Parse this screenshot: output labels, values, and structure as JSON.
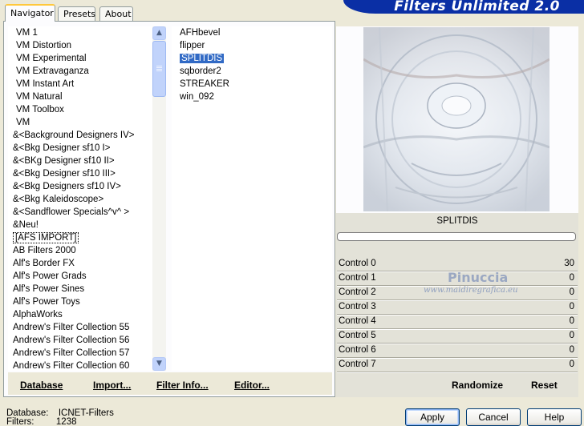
{
  "app": {
    "title": "Filters Unlimited 2.0"
  },
  "tabs": [
    {
      "label": "Navigator",
      "active": true
    },
    {
      "label": "Presets",
      "active": false
    },
    {
      "label": "About",
      "active": false
    }
  ],
  "categories": {
    "items": [
      "VM 1",
      "VM Distortion",
      "VM Experimental",
      "VM Extravaganza",
      "VM Instant Art",
      "VM Natural",
      "VM Toolbox",
      "VM",
      "&<Background Designers IV>",
      "&<Bkg Designer sf10 I>",
      "&<BKg Designer sf10 II>",
      "&<Bkg Designer sf10 III>",
      "&<Bkg Designers sf10 IV>",
      "&<Bkg Kaleidoscope>",
      "&<Sandflower Specials^v^ >",
      "&Neu!",
      "[AFS IMPORT]",
      "AB Filters 2000",
      "Alf's Border FX",
      "Alf's Power Grads",
      "Alf's Power Sines",
      "Alf's Power Toys",
      "AlphaWorks",
      "Andrew's Filter Collection 55",
      "Andrew's Filter Collection 56",
      "Andrew's Filter Collection 57",
      "Andrew's Filter Collection 60"
    ],
    "focused_index": 16
  },
  "filters": {
    "items": [
      "AFHbevel",
      "flipper",
      "SPLITDIS",
      "sqborder2",
      "STREAKER",
      "win_092"
    ],
    "selected_index": 2
  },
  "left_buttons": {
    "database": "Database",
    "import": "Import...",
    "filter_info": "Filter Info...",
    "editor": "Editor..."
  },
  "preview": {
    "filter_name": "SPLITDIS",
    "progress": 0
  },
  "watermark": {
    "name": "Pinuccia",
    "url": "www.maidiregrafica.eu"
  },
  "controls": [
    {
      "label": "Control 0",
      "value": "30"
    },
    {
      "label": "Control 1",
      "value": "0"
    },
    {
      "label": "Control 2",
      "value": "0"
    },
    {
      "label": "Control 3",
      "value": "0"
    },
    {
      "label": "Control 4",
      "value": "0"
    },
    {
      "label": "Control 5",
      "value": "0"
    },
    {
      "label": "Control 6",
      "value": "0"
    },
    {
      "label": "Control 7",
      "value": "0"
    }
  ],
  "right_buttons": {
    "randomize": "Randomize",
    "reset": "Reset"
  },
  "status": {
    "database_label": "Database:",
    "database_value": "ICNET-Filters",
    "filters_label": "Filters:",
    "filters_value": "1238"
  },
  "dialog_buttons": {
    "apply": "Apply",
    "cancel": "Cancel",
    "help": "Help"
  },
  "colors": {
    "selection": "#316ac5",
    "banner": "#0a2fa5",
    "window_bg": "#ece9d8"
  }
}
